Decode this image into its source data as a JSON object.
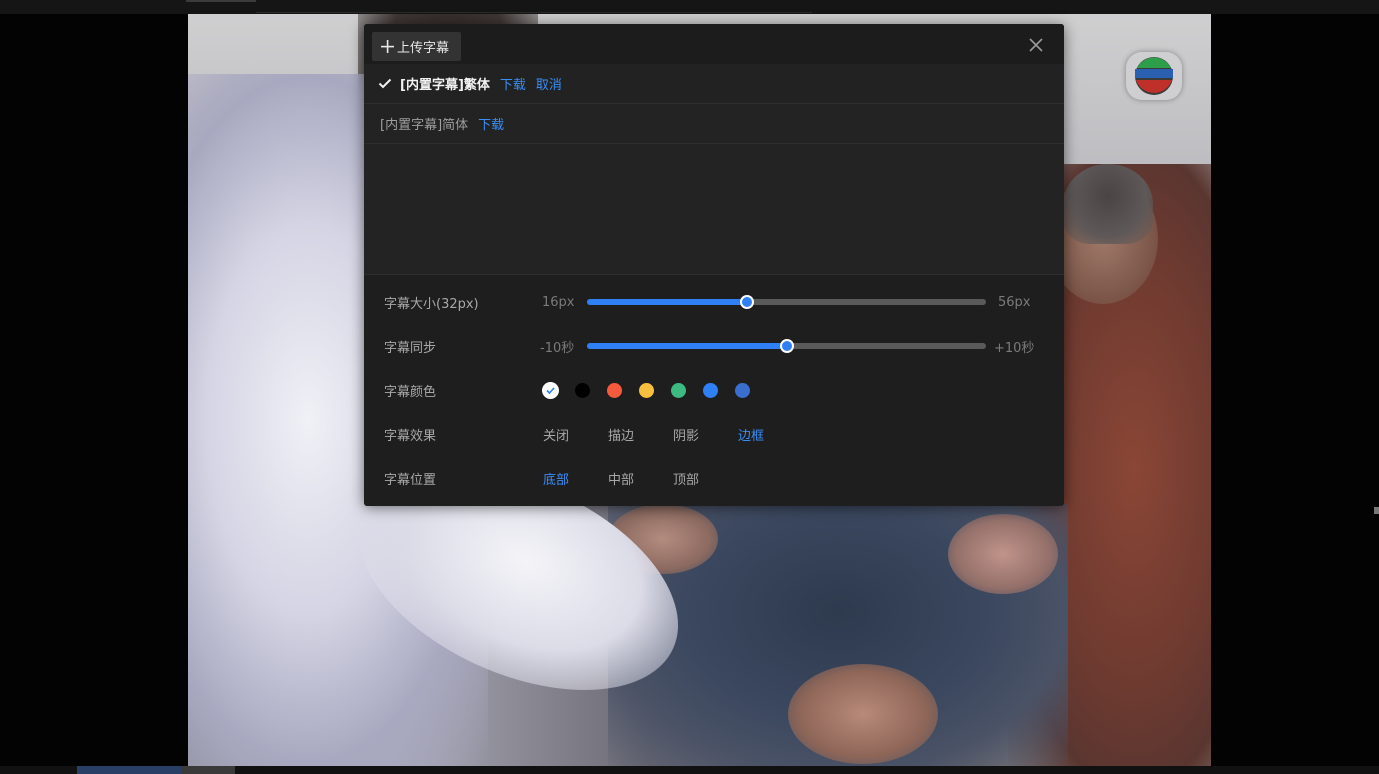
{
  "panel": {
    "upload_label": "上传字幕",
    "subtitles": [
      {
        "name": "[内置字幕]繁体",
        "download": "下载",
        "cancel": "取消",
        "selected": true
      },
      {
        "name": "[内置字幕]简体",
        "download": "下载",
        "selected": false
      }
    ]
  },
  "settings": {
    "size": {
      "label": "字幕大小(32px)",
      "min": "16px",
      "max": "56px",
      "value": 32,
      "range": [
        16,
        56
      ]
    },
    "sync": {
      "label": "字幕同步",
      "min": "-10秒",
      "max": "+10秒",
      "value": 0,
      "range": [
        -10,
        10
      ]
    },
    "color": {
      "label": "字幕颜色",
      "swatches": [
        "#ffffff",
        "#000000",
        "#f55a3c",
        "#f7bf3e",
        "#3dba82",
        "#2f80f5",
        "#3a6fd0"
      ],
      "selected_index": 0
    },
    "effect": {
      "label": "字幕效果",
      "options": [
        "关闭",
        "描边",
        "阴影",
        "边框"
      ],
      "selected_index": 3
    },
    "position": {
      "label": "字幕位置",
      "options": [
        "底部",
        "中部",
        "顶部"
      ],
      "selected_index": 0
    }
  },
  "icons": {
    "upload": "plus-icon",
    "close": "close-icon",
    "check": "check-icon",
    "channel": "tv-channel-logo-icon"
  }
}
